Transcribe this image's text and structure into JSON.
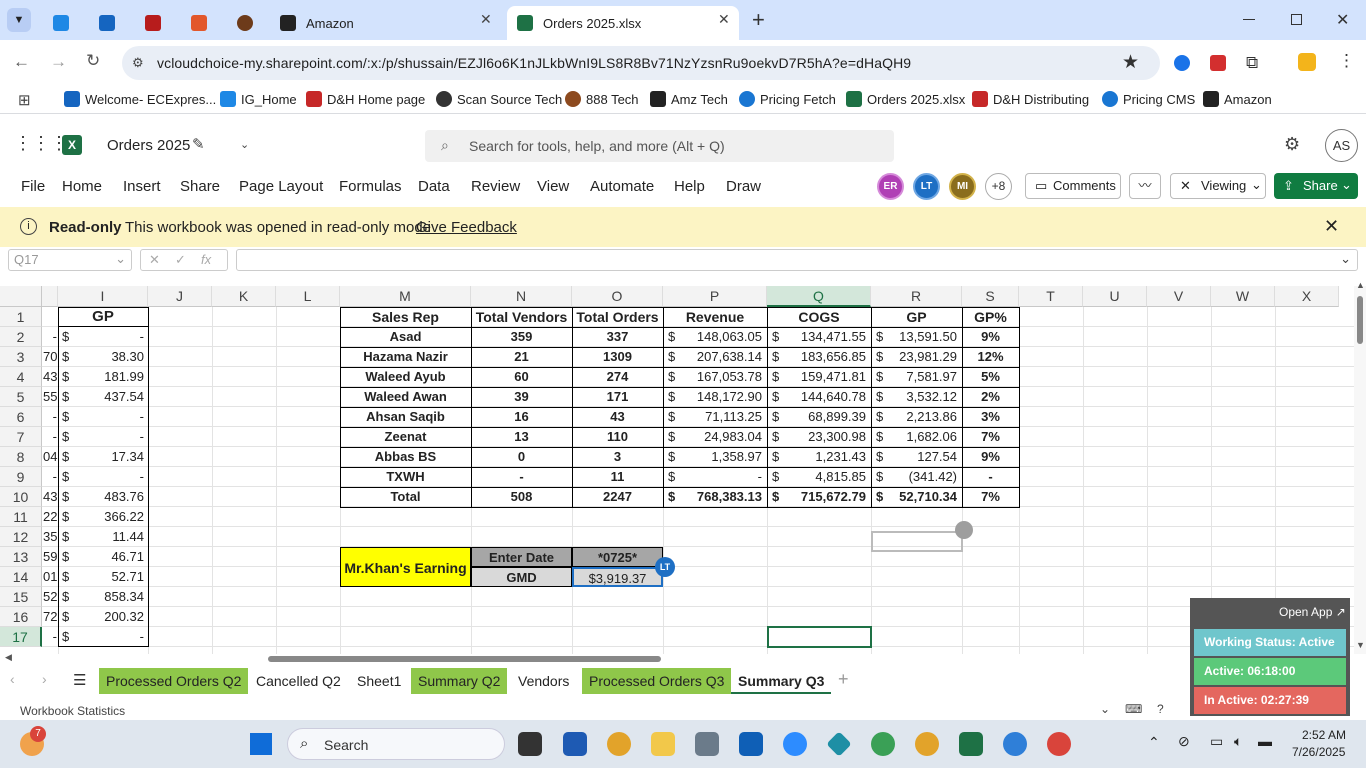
{
  "browser": {
    "tabs": [
      {
        "label": "",
        "icon": "ec-icon"
      },
      {
        "label": "",
        "icon": "bookmark-app-icon"
      },
      {
        "label": "",
        "icon": "dh-icon"
      },
      {
        "label": "",
        "icon": "s-icon"
      },
      {
        "label": "",
        "icon": "888-icon"
      },
      {
        "label": "Amazon",
        "icon": "amazon-icon"
      },
      {
        "label": "Orders 2025.xlsx",
        "icon": "excel-icon"
      }
    ],
    "new_tab": "+",
    "url": "vcloudchoice-my.sharepoint.com/:x:/p/shussain/EZJl6o6K1nJLkbWnI9LS8R8Bv71NzYzsnRu9oekvD7R5hA?e=dHaQH9"
  },
  "bookmarks": [
    {
      "label": "Welcome- ECExpres...",
      "color": "#1565c0"
    },
    {
      "label": "IG_Home",
      "color": "#1e88e5"
    },
    {
      "label": "D&H Home page",
      "color": "#c62828"
    },
    {
      "label": "Scan Source Tech",
      "color": "#333333"
    },
    {
      "label": "888 Tech",
      "color": "#8d4a1f"
    },
    {
      "label": "Amz Tech",
      "color": "#222222"
    },
    {
      "label": "Pricing Fetch",
      "color": "#1976d2"
    },
    {
      "label": "Orders 2025.xlsx",
      "color": "#1e7145"
    },
    {
      "label": "D&H Distributing",
      "color": "#c62828"
    },
    {
      "label": "Pricing CMS",
      "color": "#1976d2"
    },
    {
      "label": "Amazon",
      "color": "#222222"
    }
  ],
  "excel": {
    "file_title": "Orders 2025",
    "search_placeholder": "Search for tools, help, and more (Alt + Q)",
    "user_initials": "AS",
    "menu": [
      "File",
      "Home",
      "Insert",
      "Share",
      "Page Layout",
      "Formulas",
      "Data",
      "Review",
      "View",
      "Automate",
      "Help",
      "Draw"
    ],
    "collaborators": [
      {
        "initials": "ER",
        "color": "#b03fb5"
      },
      {
        "initials": "LT",
        "color": "#1e6fc4"
      },
      {
        "initials": "MI",
        "color": "#8a6d1d"
      }
    ],
    "more_collaborators": "+8",
    "comments_label": "Comments",
    "viewing_label": "Viewing",
    "share_label": "Share",
    "banner": {
      "title": "Read-only",
      "message": "This workbook was opened in read-only mode",
      "link": "Give Feedback"
    },
    "name_box": "Q17",
    "fx_label": "fx"
  },
  "sheet": {
    "columns": [
      "I",
      "J",
      "K",
      "L",
      "M",
      "N",
      "O",
      "P",
      "Q",
      "R",
      "S",
      "T",
      "U",
      "V",
      "W",
      "X"
    ],
    "rows": [
      "1",
      "2",
      "3",
      "4",
      "5",
      "6",
      "7",
      "8",
      "9",
      "10",
      "11",
      "12",
      "13",
      "14",
      "15",
      "16",
      "17"
    ],
    "col_h_partial": [
      "",
      "-",
      "70",
      "43",
      "55",
      "-",
      "-",
      "04",
      "-",
      "43",
      "22",
      "35",
      "59",
      "01",
      "52",
      "72",
      "-"
    ],
    "col_i_header": "GP",
    "col_i_values": [
      "-",
      "38.30",
      "181.99",
      "437.54",
      "-",
      "-",
      "17.34",
      "-",
      "483.76",
      "366.22",
      "11.44",
      "46.71",
      "52.71",
      "858.34",
      "200.32",
      "-"
    ],
    "currency": "$",
    "table_headers": [
      "Sales Rep",
      "Total Vendors",
      "Total Orders",
      "Revenue",
      "COGS",
      "GP",
      "GP%"
    ],
    "table_rows": [
      [
        "Asad",
        "359",
        "337",
        "148,063.05",
        "134,471.55",
        "13,591.50",
        "9%"
      ],
      [
        "Hazama Nazir",
        "21",
        "1309",
        "207,638.14",
        "183,656.85",
        "23,981.29",
        "12%"
      ],
      [
        "Waleed Ayub",
        "60",
        "274",
        "167,053.78",
        "159,471.81",
        "7,581.97",
        "5%"
      ],
      [
        "Waleed Awan",
        "39",
        "171",
        "148,172.90",
        "144,640.78",
        "3,532.12",
        "2%"
      ],
      [
        "Ahsan Saqib",
        "16",
        "43",
        "71,113.25",
        "68,899.39",
        "2,213.86",
        "3%"
      ],
      [
        "Zeenat",
        "13",
        "110",
        "24,983.04",
        "23,300.98",
        "1,682.06",
        "7%"
      ],
      [
        "Abbas BS",
        "0",
        "3",
        "1,358.97",
        "1,231.43",
        "127.54",
        "9%"
      ],
      [
        "TXWH",
        "-",
        "11",
        "-",
        "4,815.85",
        "(341.42)",
        "-"
      ],
      [
        "Total",
        "508",
        "2247",
        "768,383.13",
        "715,672.79",
        "52,710.34",
        "7%"
      ]
    ],
    "earning_label": "Mr.Khan's Earning",
    "enter_date_label": "Enter Date",
    "date_value": "*0725*",
    "gmd_label": "GMD",
    "gmd_value": "$3,919.37",
    "cursor_badge": "LT"
  },
  "sheet_tabs": [
    {
      "label": "Processed Orders Q2",
      "green": true
    },
    {
      "label": "Cancelled Q2",
      "green": false
    },
    {
      "label": "Sheet1",
      "green": false
    },
    {
      "label": "Summary Q2",
      "green": true
    },
    {
      "label": "Vendors",
      "green": false
    },
    {
      "label": "Processed Orders Q3",
      "green": true
    },
    {
      "label": "Summary Q3",
      "green": false,
      "active": true
    }
  ],
  "status": {
    "left": "Workbook Statistics"
  },
  "widget": {
    "open_app": "Open App ↗",
    "status": "Working Status: Active",
    "active": "Active: 06:18:00",
    "inactive": "In Active: 02:27:39"
  },
  "taskbar": {
    "search": "Search",
    "notification_count": "7",
    "time": "2:52 AM",
    "date": "7/26/2025"
  }
}
